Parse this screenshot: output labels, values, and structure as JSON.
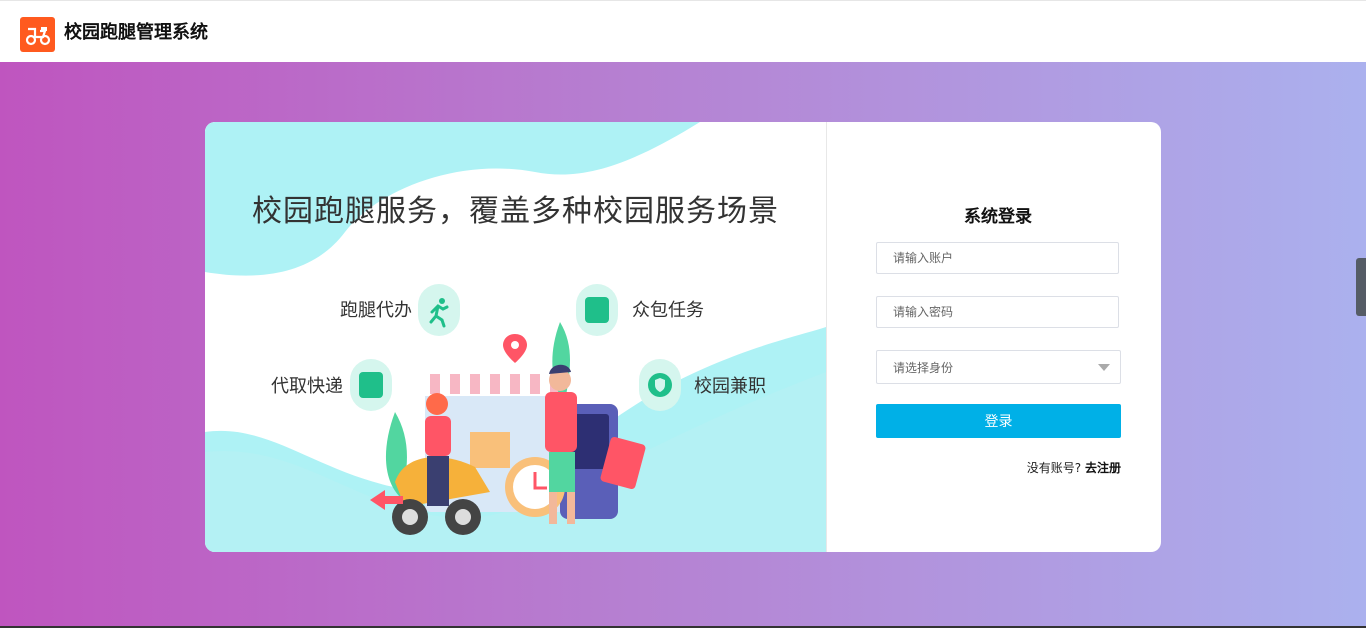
{
  "app": {
    "title": "校园跑腿管理系统",
    "brand_color": "#ff5a1f"
  },
  "illustration": {
    "headline": "校园跑腿服务，覆盖多种校园服务场景",
    "features": [
      {
        "label": "跑腿代办",
        "icon": "running-person-icon"
      },
      {
        "label": "众包任务",
        "icon": "document-list-icon"
      },
      {
        "label": "代取快递",
        "icon": "package-box-icon"
      },
      {
        "label": "校园兼职",
        "icon": "shield-badge-icon"
      }
    ]
  },
  "login": {
    "title": "系统登录",
    "account_placeholder": "请输入账户",
    "password_placeholder": "请输入密码",
    "role_placeholder": "请选择身份",
    "submit_label": "登录",
    "no_account_text": "没有账号?",
    "register_link": "去注册",
    "accent_color": "#00b0e7"
  },
  "colors": {
    "bg_start": "#bf55bf",
    "bg_end": "#abb1ee",
    "illus_teal": "#aef2f5"
  }
}
